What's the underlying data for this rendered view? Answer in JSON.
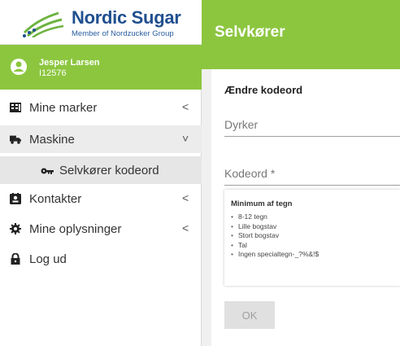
{
  "logo": {
    "brand": "Nordic Sugar",
    "tagline": "Member of Nordzucker Group",
    "colors": {
      "brand_blue": "#1f4f8f",
      "accent_green": "#6db33f"
    }
  },
  "user": {
    "name": "Jesper Larsen",
    "id": "I12576"
  },
  "sidebar": {
    "items": [
      {
        "label": "Mine marker",
        "icon": "map-grid-icon",
        "chevron": "<"
      },
      {
        "label": "Maskine",
        "icon": "truck-icon",
        "chevron": "˅"
      },
      {
        "label": "Selvkører kodeord",
        "icon": "key-icon"
      },
      {
        "label": "Kontakter",
        "icon": "contact-card-icon",
        "chevron": "<"
      },
      {
        "label": "Mine oplysninger",
        "icon": "gear-icon",
        "chevron": "<"
      },
      {
        "label": "Log ud",
        "icon": "lock-icon"
      }
    ]
  },
  "header": {
    "title": "Selvkører",
    "color": "#8cc63f"
  },
  "form": {
    "heading": "Ændre kodeord",
    "dyrker_placeholder": "Dyrker",
    "kodeord_placeholder": "Kodeord *",
    "rules_title": "Minimum af tegn",
    "rules": [
      "8-12 tegn",
      "Lille bogstav",
      "Stort bogstav",
      "Tal",
      "Ingen specialtegn-_?%&!$"
    ],
    "ok_label": "OK"
  }
}
